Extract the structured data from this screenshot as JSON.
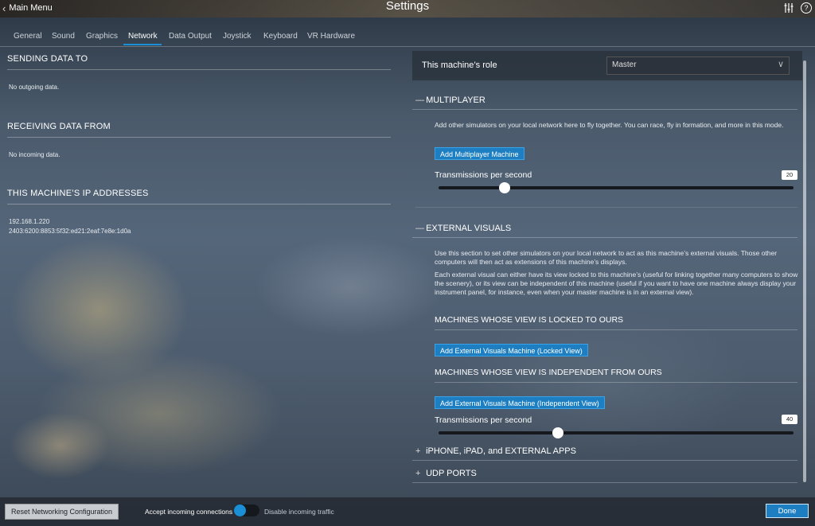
{
  "window": {
    "title": "Settings",
    "back_label": "Main Menu"
  },
  "tabs": [
    {
      "label": "General"
    },
    {
      "label": "Sound"
    },
    {
      "label": "Graphics"
    },
    {
      "label": "Network"
    },
    {
      "label": "Data Output"
    },
    {
      "label": "Joystick"
    },
    {
      "label": "Keyboard"
    },
    {
      "label": "VR Hardware"
    }
  ],
  "active_tab": "Network",
  "left": {
    "sending": {
      "title": "SENDING DATA TO",
      "text": "No outgoing data."
    },
    "receiving": {
      "title": "RECEIVING DATA FROM",
      "text": "No incoming data."
    },
    "ip": {
      "title": "THIS MACHINE’S IP ADDRESSES",
      "addresses": [
        "192.168.1.220",
        "2403:6200:8853:5f32:ed21:2eaf:7e8e:1d0a"
      ]
    }
  },
  "role": {
    "label": "This machine’s role",
    "value": "Master"
  },
  "multiplayer": {
    "marker": "—",
    "title": "MULTIPLAYER",
    "description": "Add other simulators on your local network here to fly together. You can race, fly in formation, and more in this mode.",
    "add_button": "Add Multiplayer Machine",
    "tps_label": "Transmissions per second",
    "tps_value": "20"
  },
  "external_visuals": {
    "marker": "—",
    "title": "EXTERNAL VISUALS",
    "description1": "Use this section to set other simulators on your local network to act as this machine’s external visuals. Those other computers will then act as extensions of this machine’s displays.",
    "description2": "Each external visual can either have its view locked to this machine’s (useful for linking together many computers to show the scenery), or its view can be independent of this machine (useful if you want to have one machine always display your instrument panel, for instance, even when your master machine is in an external view).",
    "locked_title": "MACHINES WHOSE VIEW IS LOCKED TO OURS",
    "locked_button": "Add External Visuals Machine (Locked View)",
    "independent_title": "MACHINES WHOSE VIEW IS INDEPENDENT FROM OURS",
    "independent_button": "Add External Visuals Machine (Independent View)",
    "tps_label": "Transmissions per second",
    "tps_value": "40"
  },
  "iphone": {
    "marker": "+",
    "title": "iPHONE, iPAD, and EXTERNAL APPS"
  },
  "udp": {
    "marker": "+",
    "title": "UDP PORTS"
  },
  "footer": {
    "reset_button": "Reset Networking Configuration",
    "accept_label": "Accept incoming connections",
    "disable_label": "Disable incoming traffic",
    "done_button": "Done"
  },
  "colors": {
    "accent": "#1d7fc2",
    "active_tab_underline": "#1a8fd6"
  },
  "icons": {
    "back": "chevron-left-icon",
    "sliders": "sliders-icon",
    "help": "help-icon"
  }
}
